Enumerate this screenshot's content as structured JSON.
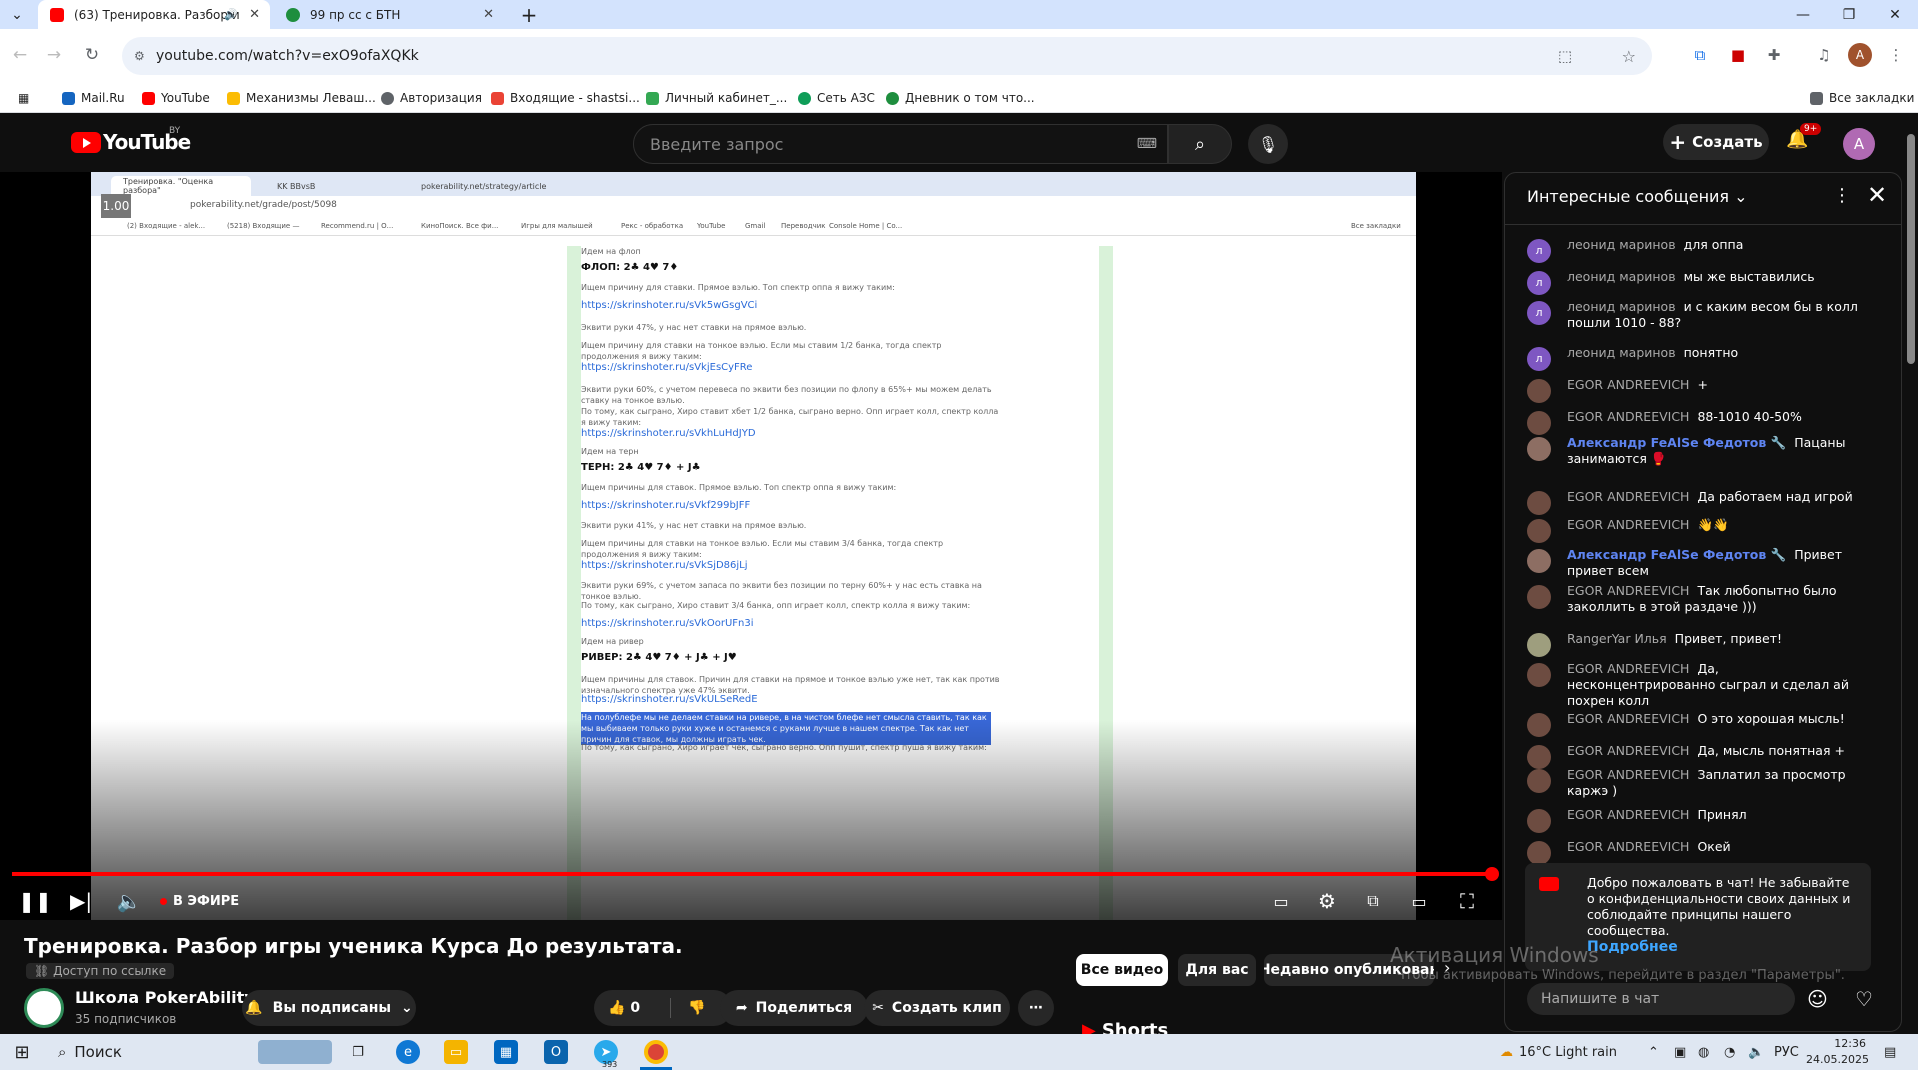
{
  "browser": {
    "tabs": [
      {
        "title": "(63) Тренировка. Разбор и",
        "active": true
      },
      {
        "title": "99 пр сс с БТН",
        "active": false
      }
    ],
    "url": "youtube.com/watch?v=exO9ofaXQKk",
    "bookmarks": [
      "Mail.Ru",
      "YouTube",
      "Механизмы Леваш...",
      "Авторизация",
      "Входящие - shastsi...",
      "Личный кабинет_...",
      "Сеть АЗС",
      "Дневник о том что..."
    ],
    "all_bookmarks": "Все закладки",
    "profile_initial": "A"
  },
  "youtube": {
    "logo": "YouTube",
    "country": "BY",
    "search_placeholder": "Введите запрос",
    "create_label": "Создать",
    "notifications": "9+",
    "avatar_initial": "A"
  },
  "player": {
    "live_label": "В ЭФИРЕ",
    "speed": "1.00",
    "screen": {
      "tabs": [
        "Тренировка. \"Оценка разбора\"",
        "KK BBvsB",
        "pokerability.net/strategy/article"
      ],
      "url": "pokerability.net/grade/post/5098",
      "bookmarks": [
        "(2) Входящие - alek...",
        "(5218) Входящие —",
        "Recommend.ru | О...",
        "КиноПоиск. Все фи...",
        "Игры для малышей",
        "Рекс - обработка",
        "YouTube",
        "Gmail",
        "Переводчик",
        "Console Home | Co...",
        "Все закладки"
      ],
      "lines": [
        {
          "t": "Идем на флоп",
          "k": "text"
        },
        {
          "t": "ФЛОП: 2♣ 4♥ 7♦",
          "k": "head"
        },
        {
          "t": "Ищем причину для ставки. Прямое вэлью. Топ спектр оппа я вижу таким:",
          "k": "text"
        },
        {
          "t": "https://skrinshoter.ru/sVk5wGsgVCi",
          "k": "link"
        },
        {
          "t": "Эквити руки 47%, у нас нет ставки на прямое вэлью.",
          "k": "text"
        },
        {
          "t": "Ищем причину для ставки на тонкое вэлью. Если мы ставим 1/2 банка, тогда спектр продолжения я вижу таким:",
          "k": "text"
        },
        {
          "t": "https://skrinshoter.ru/sVkjEsCyFRe",
          "k": "link"
        },
        {
          "t": "Эквити руки 60%, с учетом перевеса по эквити без позиции по флопу в 65%+ мы можем делать ставку на тонкое вэлью.",
          "k": "text"
        },
        {
          "t": "По тому, как сыграно, Хиро ставит хбет 1/2 банка, сыграно верно. Опп играет колл, спектр колла я вижу таким:",
          "k": "text"
        },
        {
          "t": "https://skrinshoter.ru/sVkhLuHdJYD",
          "k": "link"
        },
        {
          "t": "Идем на терн",
          "k": "text"
        },
        {
          "t": "ТЕРН: 2♣ 4♥ 7♦ + J♣",
          "k": "head"
        },
        {
          "t": "Ищем причины для ставок. Прямое вэлью. Топ спектр оппа я вижу таким:",
          "k": "text"
        },
        {
          "t": "https://skrinshoter.ru/sVkf299bJFF",
          "k": "link"
        },
        {
          "t": "Эквити руки 41%, у нас нет ставки на прямое вэлью.",
          "k": "text"
        },
        {
          "t": "Ищем причины для ставки на тонкое вэлью. Если мы ставим 3/4 банка, тогда спектр продолжения я вижу таким:",
          "k": "text"
        },
        {
          "t": "https://skrinshoter.ru/sVkSjD86jLj",
          "k": "link"
        },
        {
          "t": "Эквити руки 69%, с учетом запаса по эквити без позиции по терну 60%+ у нас есть ставка на тонкое вэлью.",
          "k": "text"
        },
        {
          "t": "По тому, как сыграно, Хиро ставит 3/4 банка, опп играет колл, спектр колла я вижу таким:",
          "k": "text"
        },
        {
          "t": "https://skrinshoter.ru/sVkOorUFn3i",
          "k": "link"
        },
        {
          "t": "Идем на ривер",
          "k": "text"
        },
        {
          "t": "РИВЕР: 2♣ 4♥ 7♦ + J♣ + J♥",
          "k": "head"
        },
        {
          "t": "Ищем причины для ставок. Причин для ставки на прямое и тонкое вэлью уже нет, так как против изначального спектра уже 47% эквити.",
          "k": "text"
        },
        {
          "t": "https://skrinshoter.ru/sVkULSeRedE",
          "k": "link"
        },
        {
          "t": "На полублефе мы не делаем ставки на ривере, в на чистом блефе нет смысла ставить, так как мы выбиваем только руки хуже и останемся с руками лучше в нашем спектре. Так как нет причин для ставок, мы должны играть чек.",
          "k": "sel"
        },
        {
          "t": "По тому, как сыграно, Хиро играет чек, сыграно верно. Опп пушит, спектр пуша я вижу таким:",
          "k": "text"
        }
      ]
    }
  },
  "chat": {
    "title": "Интересные сообщения",
    "messages": [
      {
        "author": "леонид маринов",
        "text": "для оппа",
        "initial": "л",
        "color": "#7e57c2",
        "mod": false
      },
      {
        "author": "леонид маринов",
        "text": "мы же выставились",
        "initial": "л",
        "color": "#7e57c2",
        "mod": false
      },
      {
        "author": "леонид маринов",
        "text": "и с каким весом бы в колл пошли 1010 - 88?",
        "initial": "л",
        "color": "#7e57c2",
        "mod": false
      },
      {
        "author": "леонид маринов",
        "text": "понятно",
        "initial": "л",
        "color": "#7e57c2",
        "mod": false
      },
      {
        "author": "EGOR ANDREEVICH",
        "text": "+",
        "initial": "",
        "color": "#6d4c41",
        "mod": false
      },
      {
        "author": "EGOR ANDREEVICH",
        "text": "88-1010 40-50%",
        "initial": "",
        "color": "#6d4c41",
        "mod": false
      },
      {
        "author": "Александр FeAlSe Федотов 🔧",
        "text": "Пацаны занимаются 🥊",
        "initial": "",
        "color": "#8d6e63",
        "mod": true
      },
      {
        "author": "EGOR ANDREEVICH",
        "text": "Да работаем над игрой",
        "initial": "",
        "color": "#6d4c41",
        "mod": false
      },
      {
        "author": "EGOR ANDREEVICH",
        "text": "👋👋",
        "initial": "",
        "color": "#6d4c41",
        "mod": false
      },
      {
        "author": "Александр FeAlSe Федотов 🔧",
        "text": "Привет привет всем",
        "initial": "",
        "color": "#8d6e63",
        "mod": true
      },
      {
        "author": "EGOR ANDREEVICH",
        "text": "Так любопытно было заколлить в этой раздаче )))",
        "initial": "",
        "color": "#6d4c41",
        "mod": false
      },
      {
        "author": "RangerYar Илья",
        "text": "Привет, привет!",
        "initial": "",
        "color": "#9e9e7e",
        "mod": false
      },
      {
        "author": "EGOR ANDREEVICH",
        "text": "Да, несконцентрированно сыграл и сделал ай похрен колл",
        "initial": "",
        "color": "#6d4c41",
        "mod": false
      },
      {
        "author": "EGOR ANDREEVICH",
        "text": "О это хорошая мысль!",
        "initial": "",
        "color": "#6d4c41",
        "mod": false
      },
      {
        "author": "EGOR ANDREEVICH",
        "text": "Да, мысль понятная +",
        "initial": "",
        "color": "#6d4c41",
        "mod": false
      },
      {
        "author": "EGOR ANDREEVICH",
        "text": "Заплатил за просмотр каржэ )",
        "initial": "",
        "color": "#6d4c41",
        "mod": false
      },
      {
        "author": "EGOR ANDREEVICH",
        "text": "Принял",
        "initial": "",
        "color": "#6d4c41",
        "mod": false
      },
      {
        "author": "EGOR ANDREEVICH",
        "text": "Окей",
        "initial": "",
        "color": "#6d4c41",
        "mod": false
      }
    ],
    "welcome_text": "Добро пожаловать в чат! Не забывайте о конфиденциальности своих данных и соблюдайте принципы нашего сообщества.",
    "welcome_more": "Подробнее",
    "input_placeholder": "Напишите в чат"
  },
  "video": {
    "title": "Тренировка. Разбор игры ученика Курса До результата.",
    "access": "Доступ по ссылке",
    "channel": "Школа PokerAbility",
    "subscribers": "35 подписчиков",
    "subscribed": "Вы подписаны",
    "likes": "0",
    "share": "Поделиться",
    "clip": "Создать клип"
  },
  "chips": [
    "Все видео",
    "Для вас",
    "Недавно опубликован"
  ],
  "shorts": "Shorts",
  "activation": {
    "title": "Активация Windows",
    "subtitle": "Чтобы активировать Windows, перейдите в раздел \"Параметры\"."
  },
  "taskbar": {
    "search": "Поиск",
    "weather": "16°C  Light rain",
    "lang": "РУС",
    "time": "12:36",
    "date": "24.05.2025",
    "telegram_badge": "393"
  }
}
